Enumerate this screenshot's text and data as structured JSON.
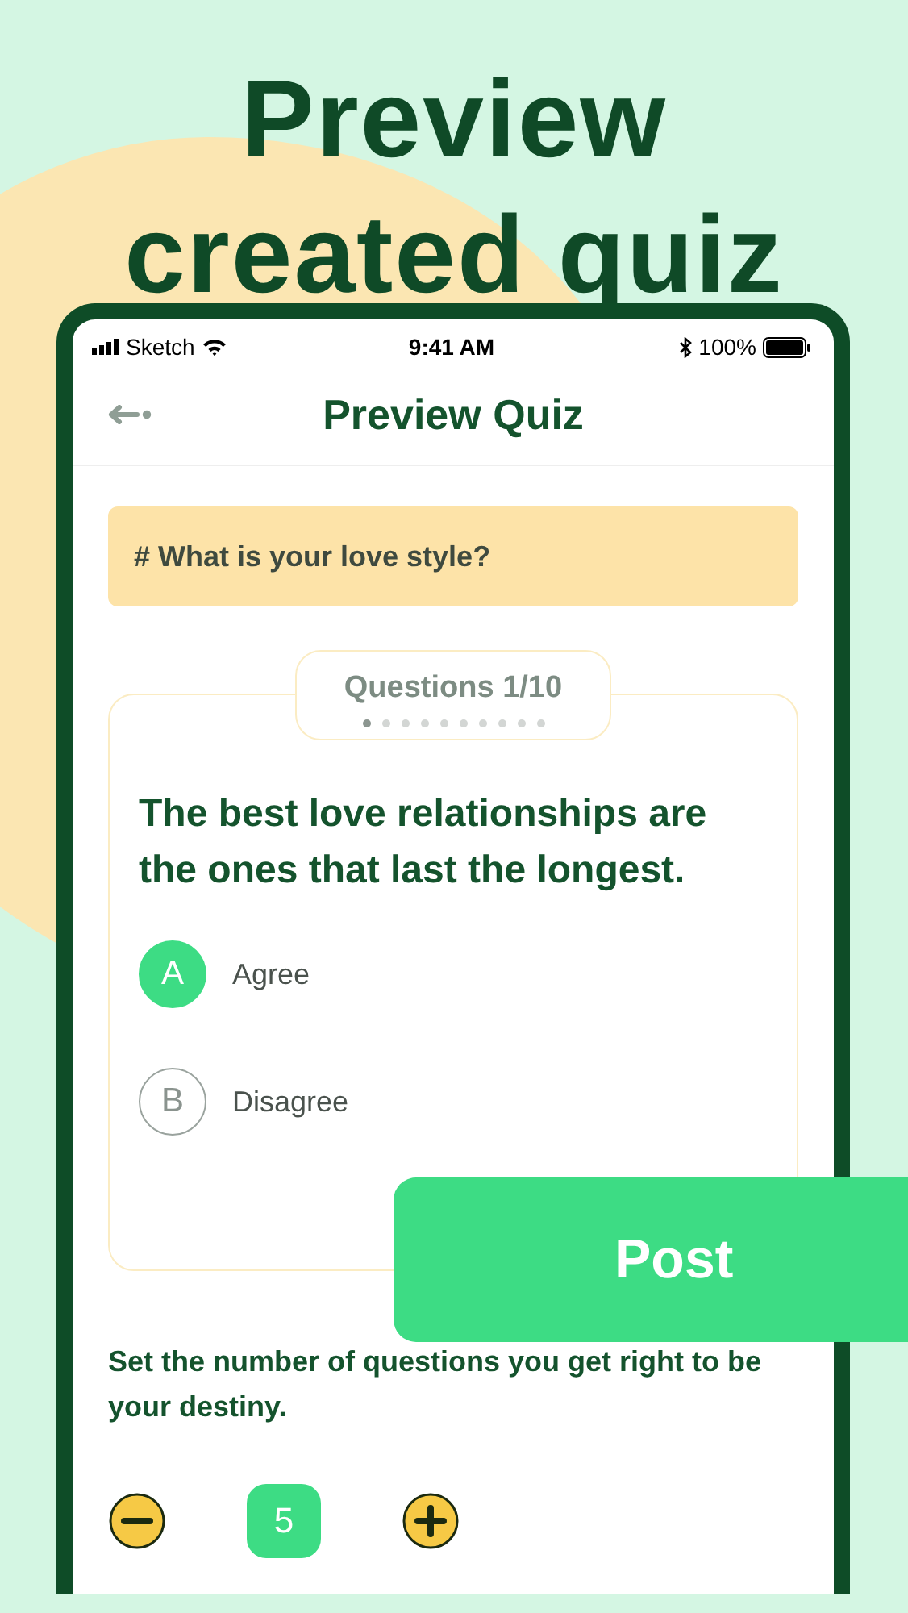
{
  "headline": [
    "Preview",
    "created quiz"
  ],
  "status_bar": {
    "carrier": "Sketch",
    "time": "9:41 AM",
    "battery": "100%"
  },
  "nav": {
    "title": "Preview Quiz"
  },
  "topic": "# What is your love style?",
  "card": {
    "tag": "Questions 1/10",
    "dots": [
      {
        "selected": true
      },
      {
        "selected": false
      },
      {
        "selected": false
      },
      {
        "selected": false
      },
      {
        "selected": false
      },
      {
        "selected": false
      },
      {
        "selected": false
      },
      {
        "selected": false
      },
      {
        "selected": false
      },
      {
        "selected": false
      }
    ],
    "question": "The best love relationships are the ones that last the longest.",
    "options": [
      {
        "letter": "A",
        "label": "Agree",
        "selected": true
      },
      {
        "letter": "B",
        "label": "Disagree",
        "selected": false
      }
    ]
  },
  "instruction": "Set the number of questions you get right to be your destiny.",
  "stepper": {
    "value": "5"
  },
  "post_button": "Post"
}
